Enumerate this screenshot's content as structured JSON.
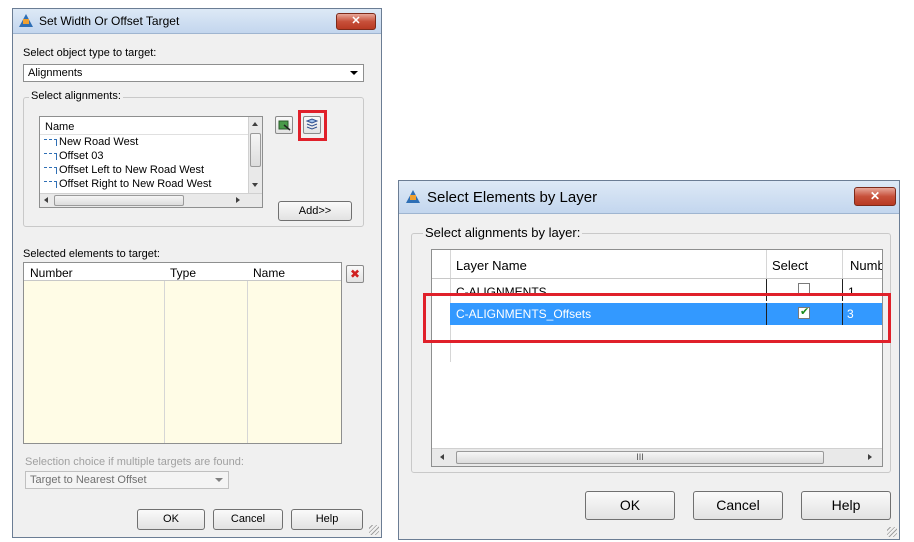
{
  "dialog1": {
    "title": "Set Width Or Offset Target",
    "close_symbol": "✕",
    "object_type_label": "Select object type to target:",
    "object_type_value": "Alignments",
    "select_group_title": "Select alignments:",
    "list_header": "Name",
    "list_items": [
      "New Road West",
      "Offset 03",
      "Offset Left to New Road West",
      "Offset Right to New Road West"
    ],
    "add_button": "Add>>",
    "selected_label": "Selected elements to target:",
    "columns": [
      "Number",
      "Type",
      "Name"
    ],
    "delete_symbol": "✖",
    "choice_label": "Selection choice if multiple targets are found:",
    "choice_value": "Target to Nearest Offset",
    "ok": "OK",
    "cancel": "Cancel",
    "help": "Help"
  },
  "dialog2": {
    "title": "Select Elements by Layer",
    "close_symbol": "✕",
    "group_title": "Select alignments by layer:",
    "columns": [
      "Layer Name",
      "Select",
      "Numb"
    ],
    "rows": [
      {
        "name": "C-ALIGNMENTS",
        "checked": false,
        "number": "1"
      },
      {
        "name": "C-ALIGNMENTS_Offsets",
        "checked": true,
        "number": "3"
      }
    ],
    "scroll_thumb_grip": "III",
    "ok": "OK",
    "cancel": "Cancel",
    "help": "Help"
  },
  "colors": {
    "highlight": "#e0202a",
    "selection": "#3399ff",
    "cream": "#fffce6"
  }
}
